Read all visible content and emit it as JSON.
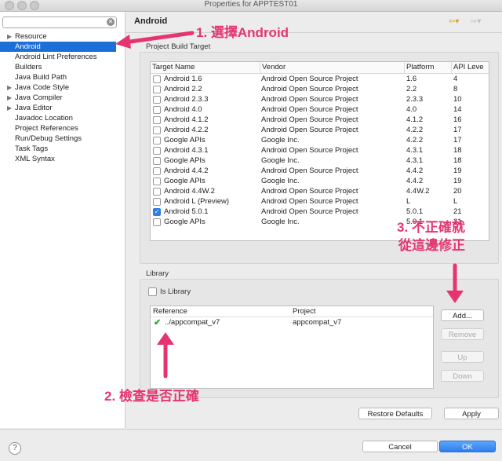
{
  "window": {
    "title": "Properties for APPTEST01"
  },
  "sidebar": {
    "filter_placeholder": "",
    "items": [
      {
        "label": "Resource",
        "expandable": true
      },
      {
        "label": "Android",
        "expandable": false,
        "selected": true
      },
      {
        "label": "Android Lint Preferences",
        "expandable": false
      },
      {
        "label": "Builders",
        "expandable": false
      },
      {
        "label": "Java Build Path",
        "expandable": false
      },
      {
        "label": "Java Code Style",
        "expandable": true
      },
      {
        "label": "Java Compiler",
        "expandable": true
      },
      {
        "label": "Java Editor",
        "expandable": true
      },
      {
        "label": "Javadoc Location",
        "expandable": false
      },
      {
        "label": "Project References",
        "expandable": false
      },
      {
        "label": "Run/Debug Settings",
        "expandable": false
      },
      {
        "label": "Task Tags",
        "expandable": false
      },
      {
        "label": "XML Syntax",
        "expandable": false
      }
    ]
  },
  "header": {
    "title": "Android",
    "back_icon": "back-arrow-icon",
    "forward_icon": "forward-arrow-icon"
  },
  "build_target": {
    "group_label": "Project Build Target",
    "columns": [
      "Target Name",
      "Vendor",
      "Platform",
      "API Leve"
    ],
    "rows": [
      {
        "name": "Android 1.6",
        "vendor": "Android Open Source Project",
        "platform": "1.6",
        "api": "4",
        "checked": false
      },
      {
        "name": "Android 2.2",
        "vendor": "Android Open Source Project",
        "platform": "2.2",
        "api": "8",
        "checked": false
      },
      {
        "name": "Android 2.3.3",
        "vendor": "Android Open Source Project",
        "platform": "2.3.3",
        "api": "10",
        "checked": false
      },
      {
        "name": "Android 4.0",
        "vendor": "Android Open Source Project",
        "platform": "4.0",
        "api": "14",
        "checked": false
      },
      {
        "name": "Android 4.1.2",
        "vendor": "Android Open Source Project",
        "platform": "4.1.2",
        "api": "16",
        "checked": false
      },
      {
        "name": "Android 4.2.2",
        "vendor": "Android Open Source Project",
        "platform": "4.2.2",
        "api": "17",
        "checked": false
      },
      {
        "name": "Google APIs",
        "vendor": "Google Inc.",
        "platform": "4.2.2",
        "api": "17",
        "checked": false
      },
      {
        "name": "Android 4.3.1",
        "vendor": "Android Open Source Project",
        "platform": "4.3.1",
        "api": "18",
        "checked": false
      },
      {
        "name": "Google APIs",
        "vendor": "Google Inc.",
        "platform": "4.3.1",
        "api": "18",
        "checked": false
      },
      {
        "name": "Android 4.4.2",
        "vendor": "Android Open Source Project",
        "platform": "4.4.2",
        "api": "19",
        "checked": false
      },
      {
        "name": "Google APIs",
        "vendor": "Google Inc.",
        "platform": "4.4.2",
        "api": "19",
        "checked": false
      },
      {
        "name": "Android 4.4W.2",
        "vendor": "Android Open Source Project",
        "platform": "4.4W.2",
        "api": "20",
        "checked": false
      },
      {
        "name": "Android L (Preview)",
        "vendor": "Android Open Source Project",
        "platform": "L",
        "api": "L",
        "checked": false
      },
      {
        "name": "Android 5.0.1",
        "vendor": "Android Open Source Project",
        "platform": "5.0.1",
        "api": "21",
        "checked": true
      },
      {
        "name": "Google APIs",
        "vendor": "Google Inc.",
        "platform": "5.0.1",
        "api": "21",
        "checked": false
      }
    ]
  },
  "library": {
    "group_label": "Library",
    "is_library_label": "Is Library",
    "is_library_checked": false,
    "columns": [
      "Reference",
      "Project"
    ],
    "rows": [
      {
        "reference": "../appcompat_v7",
        "project": "appcompat_v7",
        "status_icon": "check-icon"
      }
    ],
    "buttons": {
      "add": "Add...",
      "remove": "Remove",
      "up": "Up",
      "down": "Down"
    }
  },
  "actions": {
    "restore_defaults": "Restore Defaults",
    "apply": "Apply"
  },
  "footer": {
    "help_label": "?",
    "cancel": "Cancel",
    "ok": "OK"
  },
  "annotations": {
    "note1": "1. 選擇Android",
    "note2": "2. 檢查是否正確",
    "note3_line1": "3. 不正確就",
    "note3_line2": "從這邊修正",
    "color": "#e63470"
  }
}
